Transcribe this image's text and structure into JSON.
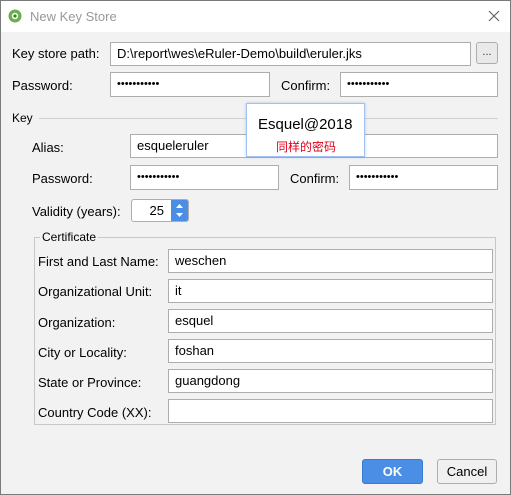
{
  "window": {
    "title": "New Key Store",
    "icon": "android-studio-icon",
    "close": "close-icon"
  },
  "keystore": {
    "path_label": "Key store path:",
    "path_value": "D:\\report\\wes\\eRuler-Demo\\build\\eruler.jks",
    "browse_label": "...",
    "password_label": "Password:",
    "password_value": "•••••••••••",
    "confirm_label": "Confirm:",
    "confirm_value": "•••••••••••"
  },
  "key": {
    "section_label": "Key",
    "alias_label": "Alias:",
    "alias_value": "esqueleruler",
    "password_label": "Password:",
    "password_value": "•••••••••••",
    "confirm_label": "Confirm:",
    "confirm_value": "•••••••••••",
    "validity_label": "Validity (years):",
    "validity_value": "25"
  },
  "certificate": {
    "group_label": "Certificate",
    "fields": [
      {
        "label": "First and Last Name:",
        "value": "weschen"
      },
      {
        "label": "Organizational Unit:",
        "value": "it"
      },
      {
        "label": "Organization:",
        "value": "esquel"
      },
      {
        "label": "City or Locality:",
        "value": "foshan"
      },
      {
        "label": "State or Province:",
        "value": "guangdong"
      },
      {
        "label": "Country Code (XX):",
        "value": ""
      }
    ]
  },
  "annotation": {
    "main": "Esquel@2018",
    "note": "同样的密码",
    "note_color": "#e0001b"
  },
  "buttons": {
    "ok": "OK",
    "cancel": "Cancel"
  },
  "colors": {
    "accent": "#4a8ee6",
    "background": "#f2f2f2"
  }
}
